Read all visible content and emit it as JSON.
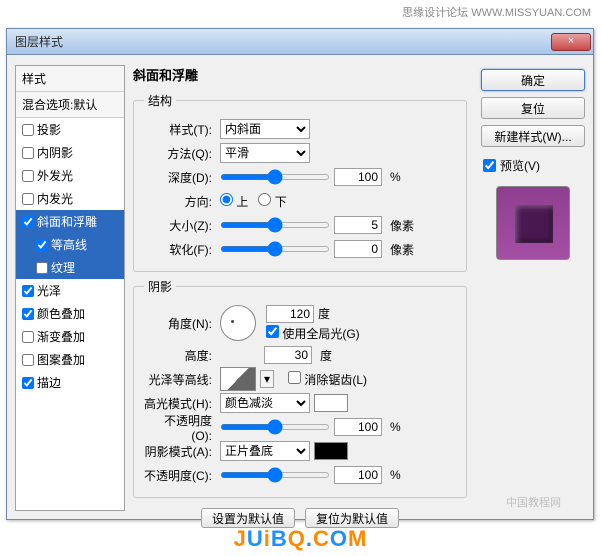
{
  "watermark_top": "思缘设计论坛  WWW.MISSYUAN.COM",
  "watermark_small": "中国教程网",
  "dialog": {
    "title": "图层样式",
    "close": "×"
  },
  "left": {
    "header": "样式",
    "blending": "混合选项:默认",
    "items": [
      {
        "label": "投影",
        "checked": false
      },
      {
        "label": "内阴影",
        "checked": false
      },
      {
        "label": "外发光",
        "checked": false
      },
      {
        "label": "内发光",
        "checked": false
      },
      {
        "label": "斜面和浮雕",
        "checked": true
      },
      {
        "label": "等高线",
        "checked": true
      },
      {
        "label": "纹理",
        "checked": false
      },
      {
        "label": "光泽",
        "checked": true
      },
      {
        "label": "颜色叠加",
        "checked": true
      },
      {
        "label": "渐变叠加",
        "checked": false
      },
      {
        "label": "图案叠加",
        "checked": false
      },
      {
        "label": "描边",
        "checked": true
      }
    ]
  },
  "center": {
    "title": "斜面和浮雕",
    "structure": {
      "legend": "结构",
      "style_label": "样式(T):",
      "style_value": "内斜面",
      "technique_label": "方法(Q):",
      "technique_value": "平滑",
      "depth_label": "深度(D):",
      "depth_value": "100",
      "depth_unit": "%",
      "direction_label": "方向:",
      "up": "上",
      "down": "下",
      "size_label": "大小(Z):",
      "size_value": "5",
      "size_unit": "像素",
      "soften_label": "软化(F):",
      "soften_value": "0",
      "soften_unit": "像素"
    },
    "shading": {
      "legend": "阴影",
      "angle_label": "角度(N):",
      "angle_value": "120",
      "angle_unit": "度",
      "global_label": "使用全局光(G)",
      "altitude_label": "高度:",
      "altitude_value": "30",
      "altitude_unit": "度",
      "gloss_label": "光泽等高线:",
      "antialias_label": "消除锯齿(L)",
      "highlight_mode_label": "高光模式(H):",
      "highlight_mode_value": "颜色减淡",
      "highlight_opacity_label": "不透明度(O):",
      "highlight_opacity_value": "100",
      "highlight_opacity_unit": "%",
      "shadow_mode_label": "阴影模式(A):",
      "shadow_mode_value": "正片叠底",
      "shadow_opacity_label": "不透明度(C):",
      "shadow_opacity_value": "100",
      "shadow_opacity_unit": "%"
    },
    "btn_default": "设置为默认值",
    "btn_reset": "复位为默认值"
  },
  "right": {
    "ok": "确定",
    "cancel": "复位",
    "new_style": "新建样式(W)...",
    "preview": "预览(V)"
  },
  "footer_logo": {
    "j": "J",
    "u": "U",
    "i": "i",
    "b": "B",
    "q": "Q",
    "dot": ".",
    "c": "C",
    "o": "O",
    "m": "M"
  }
}
